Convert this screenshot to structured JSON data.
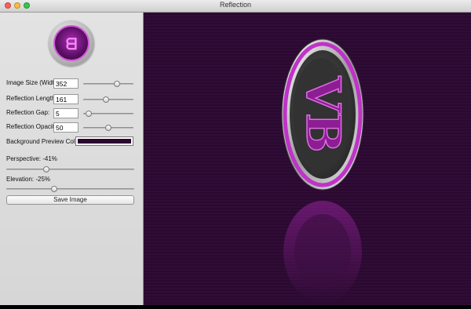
{
  "window": {
    "title": "Reflection"
  },
  "controls": {
    "image_size": {
      "label": "Image Size (Width):",
      "value": "352",
      "slider": 0.75
    },
    "reflection_length": {
      "label": "Reflection Length:",
      "value": "161",
      "slider": 0.45
    },
    "reflection_gap": {
      "label": "Reflection Gap:",
      "value": "5",
      "slider": 0.05
    },
    "reflection_opacity": {
      "label": "Reflection Opacity:",
      "value": "50",
      "slider": 0.5
    },
    "background_preview": {
      "label": "Background Preview Color:",
      "color": "#2a0830"
    },
    "perspective": {
      "label": "Perspective: -41%",
      "slider": 0.3
    },
    "elevation": {
      "label": "Elevation: -25%",
      "slider": 0.37
    }
  },
  "buttons": {
    "save": "Save Image"
  },
  "colors": {
    "canvas_bg": "#2c0a32",
    "accent": "#b12ab8"
  },
  "preview": {
    "logo_text": "VB"
  }
}
